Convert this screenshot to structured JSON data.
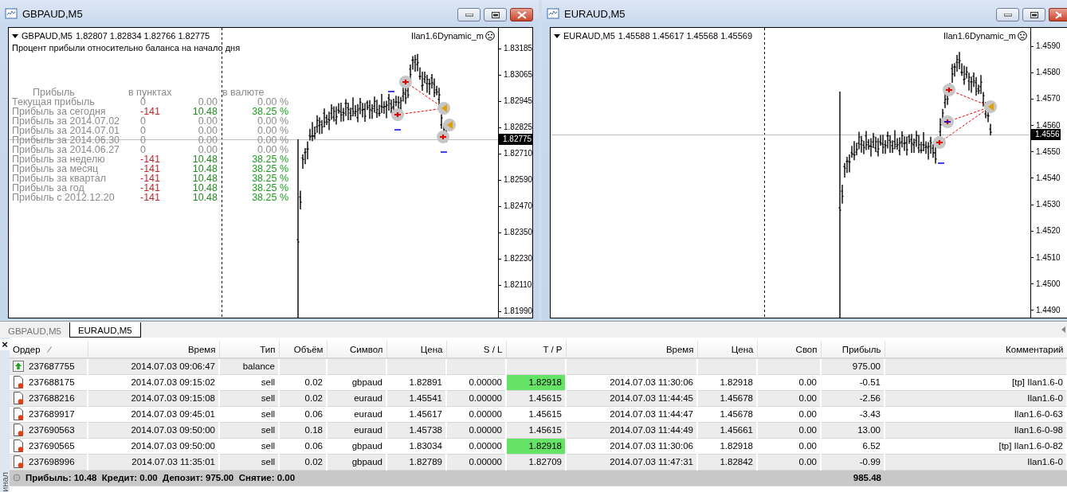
{
  "windows": [
    {
      "title": "GBPAUD,M5",
      "symbol": "GBPAUD,M5",
      "quotes": "1.82807 1.82834 1.82766 1.82775",
      "indicator": "Ilan1.6Dynamic_m",
      "subtitle": "Процент прибыли относительно баланса на начало дня",
      "profit_report": {
        "headers": [
          "Прибыль",
          "в пунктах",
          "в валюте"
        ],
        "rows": [
          {
            "label": "Текущая прибыль",
            "points": "0",
            "money": "0.00",
            "percent": "0.00 %",
            "kind": "zero"
          },
          {
            "label": "Прибыль за сегодня",
            "points": "-141",
            "money": "10.48",
            "percent": "38.25 %",
            "kind": "result"
          },
          {
            "label": "Прибыль за 2014.07.02",
            "points": "0",
            "money": "0.00",
            "percent": "0.00 %",
            "kind": "zero"
          },
          {
            "label": "Прибыль за 2014.07.01",
            "points": "0",
            "money": "0.00",
            "percent": "0.00 %",
            "kind": "zero"
          },
          {
            "label": "Прибыль за 2014.06.30",
            "points": "0",
            "money": "0.00",
            "percent": "0.00 %",
            "kind": "zero"
          },
          {
            "label": "Прибыль за 2014.06.27",
            "points": "0",
            "money": "0.00",
            "percent": "0.00 %",
            "kind": "zero"
          },
          {
            "label": "Прибыль за неделю",
            "points": "-141",
            "money": "10.48",
            "percent": "38.25 %",
            "kind": "result"
          },
          {
            "label": "Прибыль за месяц",
            "points": "-141",
            "money": "10.48",
            "percent": "38.25 %",
            "kind": "result"
          },
          {
            "label": "Прибыль за квартал",
            "points": "-141",
            "money": "10.48",
            "percent": "38.25 %",
            "kind": "result"
          },
          {
            "label": "Прибыль за год",
            "points": "-141",
            "money": "10.48",
            "percent": "38.25 %",
            "kind": "result"
          },
          {
            "label": "Прибыль с 2012.12.20",
            "points": "-141",
            "money": "10.48",
            "percent": "38.25 %",
            "kind": "result"
          }
        ]
      },
      "price_axis": [
        "1.83185",
        "1.83065",
        "1.82945",
        "1.82825",
        "1.82710",
        "1.82590",
        "1.82470",
        "1.82350",
        "1.82230",
        "1.82110",
        "1.81990"
      ],
      "current_price": "1.82775"
    },
    {
      "title": "EURAUD,M5",
      "symbol": "EURAUD,M5",
      "quotes": "1.45588 1.45617 1.45568 1.45569",
      "indicator": "Ilan1.6Dynamic_m",
      "price_axis": [
        "1.4590",
        "1.4580",
        "1.4570",
        "1.4560",
        "1.4550",
        "1.4540",
        "1.4530",
        "1.4520",
        "1.4510",
        "1.4500",
        "1.4490"
      ],
      "current_price": "1.4556"
    }
  ],
  "tabs": [
    {
      "label": "GBPAUD,M5",
      "selected": false
    },
    {
      "label": "EURAUD,M5",
      "selected": true
    }
  ],
  "sidebar": {
    "close": "×",
    "label": "инал"
  },
  "table": {
    "columns": [
      {
        "label": "Ордер",
        "sorted": true
      },
      {
        "label": "Время",
        "sorted": false
      },
      {
        "label": "Тип",
        "sorted": false
      },
      {
        "label": "Объём",
        "sorted": false
      },
      {
        "label": "Символ",
        "sorted": false
      },
      {
        "label": "Цена",
        "sorted": false
      },
      {
        "label": "S / L",
        "sorted": false
      },
      {
        "label": "T / P",
        "sorted": false
      },
      {
        "label": "Время",
        "sorted": false
      },
      {
        "label": "Цена",
        "sorted": false
      },
      {
        "label": "Своп",
        "sorted": false
      },
      {
        "label": "Прибыль",
        "sorted": false
      },
      {
        "label": "Комментарий",
        "sorted": false
      }
    ],
    "rows": [
      {
        "kind": "balance",
        "tp_hit": false,
        "cells": [
          "237687755",
          "2014.07.03 09:06:47",
          "balance",
          null,
          null,
          null,
          null,
          null,
          null,
          null,
          null,
          "975.00",
          null
        ]
      },
      {
        "kind": "sell",
        "tp_hit": true,
        "cells": [
          "237688175",
          "2014.07.03 09:15:02",
          "sell",
          "0.02",
          "gbpaud",
          "1.82891",
          "0.00000",
          "1.82918",
          "2014.07.03 11:30:06",
          "1.82918",
          "0.00",
          "-0.51",
          "[tp] Ilan1.6-0"
        ]
      },
      {
        "kind": "sell",
        "tp_hit": false,
        "cells": [
          "237688216",
          "2014.07.03 09:15:08",
          "sell",
          "0.02",
          "euraud",
          "1.45541",
          "0.00000",
          "1.45615",
          "2014.07.03 11:44:45",
          "1.45678",
          "0.00",
          "-2.56",
          "Ilan1.6-0"
        ]
      },
      {
        "kind": "sell",
        "tp_hit": false,
        "cells": [
          "237689917",
          "2014.07.03 09:45:01",
          "sell",
          "0.06",
          "euraud",
          "1.45617",
          "0.00000",
          "1.45615",
          "2014.07.03 11:44:47",
          "1.45678",
          "0.00",
          "-3.43",
          "Ilan1.6-0-63"
        ]
      },
      {
        "kind": "sell",
        "tp_hit": false,
        "cells": [
          "237690563",
          "2014.07.03 09:50:00",
          "sell",
          "0.18",
          "euraud",
          "1.45738",
          "0.00000",
          "1.45615",
          "2014.07.03 11:44:49",
          "1.45661",
          "0.00",
          "13.00",
          "Ilan1.6-0-98"
        ]
      },
      {
        "kind": "sell",
        "tp_hit": true,
        "cells": [
          "237690565",
          "2014.07.03 09:50:00",
          "sell",
          "0.06",
          "gbpaud",
          "1.83034",
          "0.00000",
          "1.82918",
          "2014.07.03 11:30:06",
          "1.82918",
          "0.00",
          "6.52",
          "[tp] Ilan1.6-0-82"
        ]
      },
      {
        "kind": "sell",
        "tp_hit": false,
        "cells": [
          "237698996",
          "2014.07.03 11:35:01",
          "sell",
          "0.02",
          "gbpaud",
          "1.82789",
          "0.00000",
          "1.82709",
          "2014.07.03 11:47:31",
          "1.82842",
          "0.00",
          "-0.99",
          "Ilan1.6-0"
        ]
      }
    ],
    "summary": {
      "text": "Прибыль: 10.48  Кредит: 0.00  Депозит: 975.00  Снятие: 0.00",
      "total": "985.48"
    }
  }
}
